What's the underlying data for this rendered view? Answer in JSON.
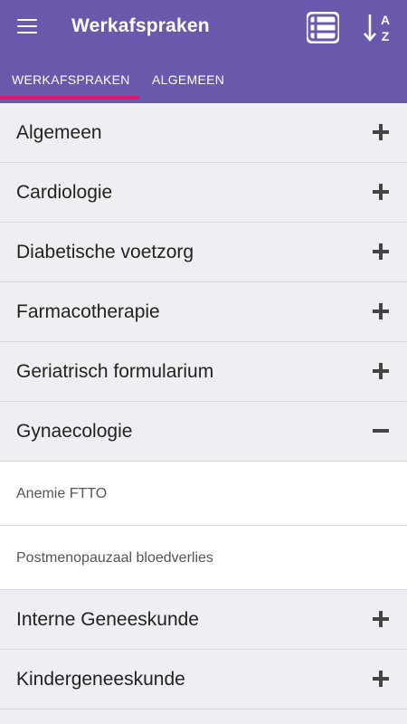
{
  "header": {
    "title": "Werkafspraken",
    "menu_icon": "hamburger-icon",
    "list_icon": "list-view-icon",
    "sort_icon": "sort-az-icon",
    "sort_letters": [
      "A",
      "Z"
    ]
  },
  "tabs": [
    {
      "label": "WERKAFSPRAKEN",
      "active": true
    },
    {
      "label": "ALGEMEEN",
      "active": false
    }
  ],
  "colors": {
    "primary": "#6a58ad",
    "indicator": "#e6136e"
  },
  "categories": [
    {
      "label": "Algemeen",
      "expanded": false
    },
    {
      "label": "Cardiologie",
      "expanded": false
    },
    {
      "label": "Diabetische voetzorg",
      "expanded": false
    },
    {
      "label": "Farmacotherapie",
      "expanded": false
    },
    {
      "label": "Geriatrisch formularium",
      "expanded": false
    },
    {
      "label": "Gynaecologie",
      "expanded": true,
      "items": [
        "Anemie FTTO",
        "Postmenopauzaal bloedverlies"
      ]
    },
    {
      "label": "Interne Geneeskunde",
      "expanded": false
    },
    {
      "label": "Kindergeneeskunde",
      "expanded": false
    }
  ]
}
